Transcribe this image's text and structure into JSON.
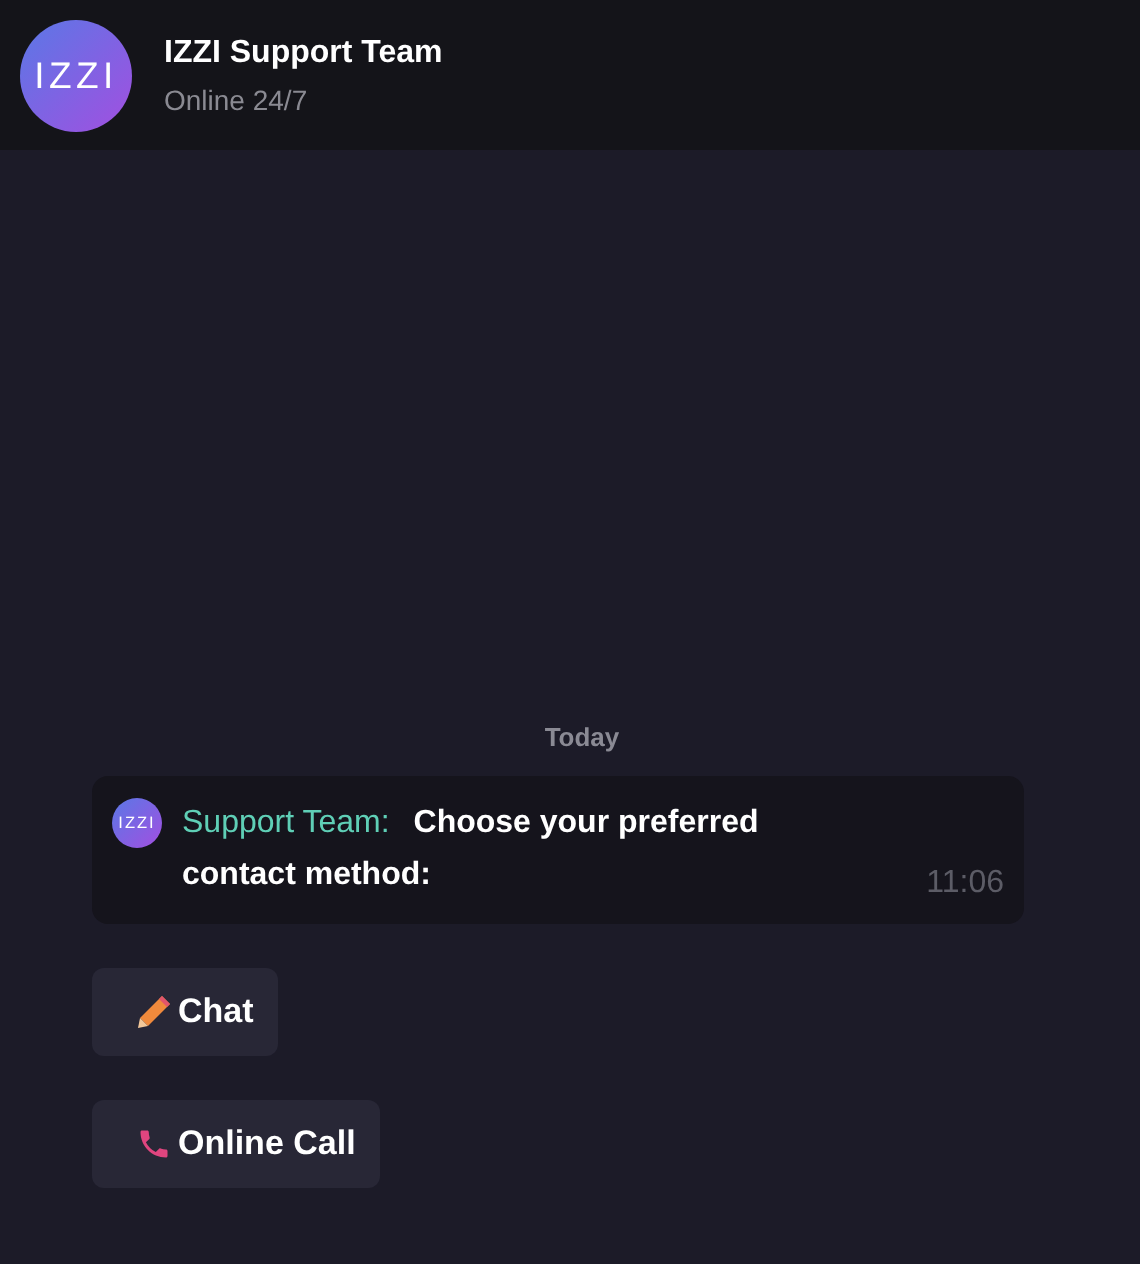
{
  "header": {
    "avatar": "IZZI",
    "title": "IZZI Support Team",
    "status": "Online 24/7"
  },
  "date_divider": "Today",
  "message": {
    "avatar": "IZZI",
    "sender": "Support Team:",
    "text": "Choose your preferred contact method:",
    "time": "11:06"
  },
  "buttons": [
    {
      "kind": "pencil",
      "label": "Chat"
    },
    {
      "kind": "phone",
      "label": "Online Call"
    }
  ]
}
